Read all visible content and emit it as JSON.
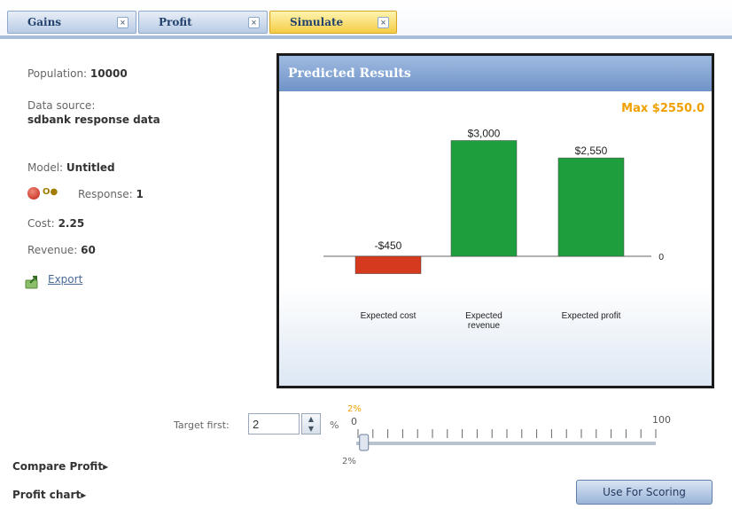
{
  "tabs": [
    {
      "label": "Gains",
      "active": false
    },
    {
      "label": "Profit",
      "active": false
    },
    {
      "label": "Simulate",
      "active": true
    }
  ],
  "info": {
    "population_label": "Population:",
    "population_value": "10000",
    "data_source_label": "Data source:",
    "data_source_value": "sdbank response data",
    "model_label": "Model:",
    "model_value": "Untitled",
    "response_toggle": "O●",
    "response_label": "Response:",
    "response_value": "1",
    "cost_label": "Cost:",
    "cost_value": "2.25",
    "revenue_label": "Revenue:",
    "revenue_value": "60",
    "export_label": "Export"
  },
  "panel": {
    "title": "Predicted Results",
    "max_label": "Max $2550.0"
  },
  "chart_data": {
    "type": "bar",
    "title": "Predicted Results",
    "categories": [
      "Expected cost",
      "Expected revenue",
      "Expected profit"
    ],
    "values": [
      -450,
      3000,
      2550
    ],
    "value_labels": [
      "-$450",
      "$3,000",
      "$2,550"
    ],
    "colors": [
      "#d63a1e",
      "#1e9e3c",
      "#1e9e3c"
    ],
    "zero_label": "0",
    "ylim": [
      -450,
      3000
    ],
    "grid": false
  },
  "target": {
    "label": "Target first:",
    "value": "2",
    "percent_sign": "%",
    "slider_current_top": "2%",
    "slider_current_bottom": "2%",
    "slider_min": "0",
    "slider_max": "100",
    "slider_value_percent": 2
  },
  "links": {
    "compare_profit": "Compare Profit",
    "profit_chart": "Profit chart"
  },
  "buttons": {
    "use_for_scoring": "Use For Scoring"
  }
}
